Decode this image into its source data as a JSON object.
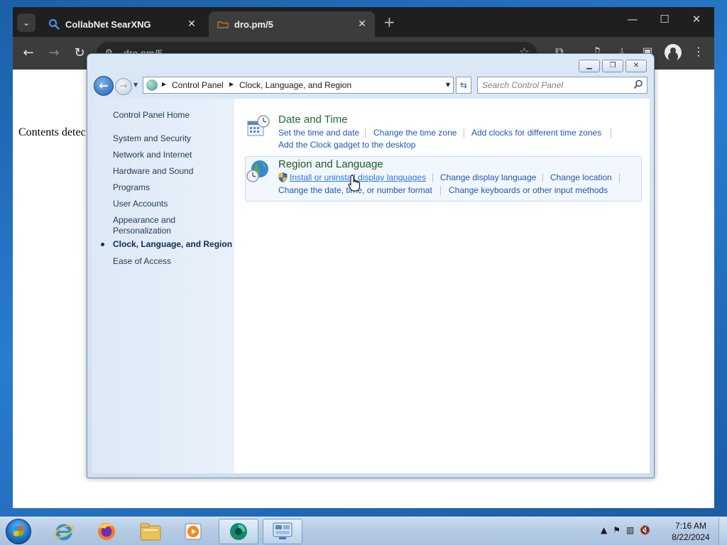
{
  "browser": {
    "tabs": [
      {
        "title": "CollabNet SearXNG",
        "active": false
      },
      {
        "title": "dro.pm/5",
        "active": true
      }
    ],
    "new_tab_label": "+",
    "window_controls": {
      "minimize": "—",
      "maximize": "☐",
      "close": "✕"
    },
    "address": "dro.pm/5",
    "page_text": "Contents detec"
  },
  "control_panel": {
    "breadcrumbs": [
      "Control Panel",
      "Clock, Language, and Region"
    ],
    "search_placeholder": "Search Control Panel",
    "sidebar": {
      "home": "Control Panel Home",
      "items": [
        "System and Security",
        "Network and Internet",
        "Hardware and Sound",
        "Programs",
        "User Accounts",
        "Appearance and Personalization",
        "Clock, Language, and Region",
        "Ease of Access"
      ],
      "current_index": 6
    },
    "categories": [
      {
        "title": "Date and Time",
        "links": [
          "Set the time and date",
          "Change the time zone",
          "Add clocks for different time zones",
          "Add the Clock gadget to the desktop"
        ]
      },
      {
        "title": "Region and Language",
        "links": [
          "Install or uninstall display languages",
          "Change display language",
          "Change location",
          "Change the date, time, or number format",
          "Change keyboards or other input methods"
        ]
      }
    ]
  },
  "taskbar": {
    "apps": [
      "internet-explorer",
      "firefox",
      "file-explorer",
      "media-player",
      "browser",
      "control-panel"
    ],
    "clock_time": "7:16 AM",
    "clock_date": "8/22/2024"
  },
  "colors": {
    "link": "#1f58b3",
    "category_title": "#1e6a2f",
    "taskbar": "#b4cbe4",
    "browser_chrome": "#1f1f1f"
  }
}
